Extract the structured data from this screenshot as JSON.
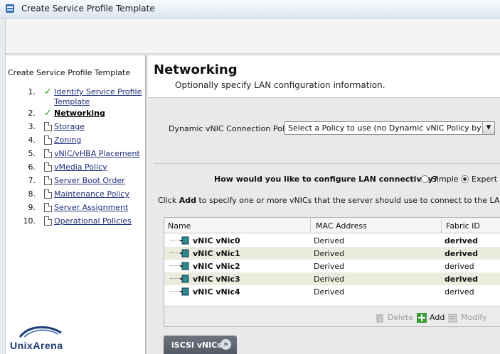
{
  "window": {
    "title": "Create Service Profile Template"
  },
  "wizard": {
    "title": "Create Service Profile Template",
    "steps": [
      {
        "num": "1.",
        "label": "Identify Service Profile",
        "label2": "Template",
        "state": "done"
      },
      {
        "num": "2.",
        "label": "Networking",
        "state": "current"
      },
      {
        "num": "3.",
        "label": "Storage",
        "state": "pending"
      },
      {
        "num": "4.",
        "label": "Zoning",
        "state": "pending"
      },
      {
        "num": "5.",
        "label": "vNIC/vHBA Placement",
        "state": "pending"
      },
      {
        "num": "6.",
        "label": "vMedia Policy",
        "state": "pending"
      },
      {
        "num": "7.",
        "label": "Server Boot Order",
        "state": "pending"
      },
      {
        "num": "8.",
        "label": "Maintenance Policy",
        "state": "pending"
      },
      {
        "num": "9.",
        "label": "Server Assignment",
        "state": "pending"
      },
      {
        "num": "10.",
        "label": "Operational Policies",
        "state": "pending"
      }
    ]
  },
  "logo": {
    "text": "UnixArena"
  },
  "main": {
    "heading": "Networking",
    "subheading": "Optionally specify LAN configuration information.",
    "policy_label": "Dynamic vNIC Connection Policy:",
    "policy_value": "Select a Policy to use (no Dynamic vNIC Policy by defa...",
    "question": "How would you like to configure LAN connectivity?",
    "radio_simple": "Simple",
    "radio_expert": "Expert",
    "selected_mode": "Expert",
    "instruction_pre": "Click ",
    "instruction_bold": "Add",
    "instruction_post": " to specify one or more vNICs that the server should use to connect to the LAN."
  },
  "table": {
    "columns": [
      "Name",
      "MAC Address",
      "Fabric ID"
    ],
    "rows": [
      {
        "name": "vNIC vNic0",
        "mac": "Derived",
        "fabric": "derived",
        "fabric_bold": true
      },
      {
        "name": "vNIC vNic1",
        "mac": "Derived",
        "fabric": "derived",
        "fabric_bold": true
      },
      {
        "name": "vNIC vNic2",
        "mac": "Derived",
        "fabric": "derived",
        "fabric_bold": false
      },
      {
        "name": "vNIC vNic3",
        "mac": "Derived",
        "fabric": "derived",
        "fabric_bold": true
      },
      {
        "name": "vNIC vNic4",
        "mac": "Derived",
        "fabric": "derived",
        "fabric_bold": false
      }
    ],
    "buttons": {
      "delete": "Delete",
      "add": "Add",
      "modify": "Modify"
    }
  },
  "iscsi": {
    "label": "iSCSI vNICs"
  },
  "colors": {
    "check": "#1f9a1f",
    "link": "#1e2e7a",
    "iscsi_bar": "#5f6672",
    "alt_row": "#ececde"
  }
}
